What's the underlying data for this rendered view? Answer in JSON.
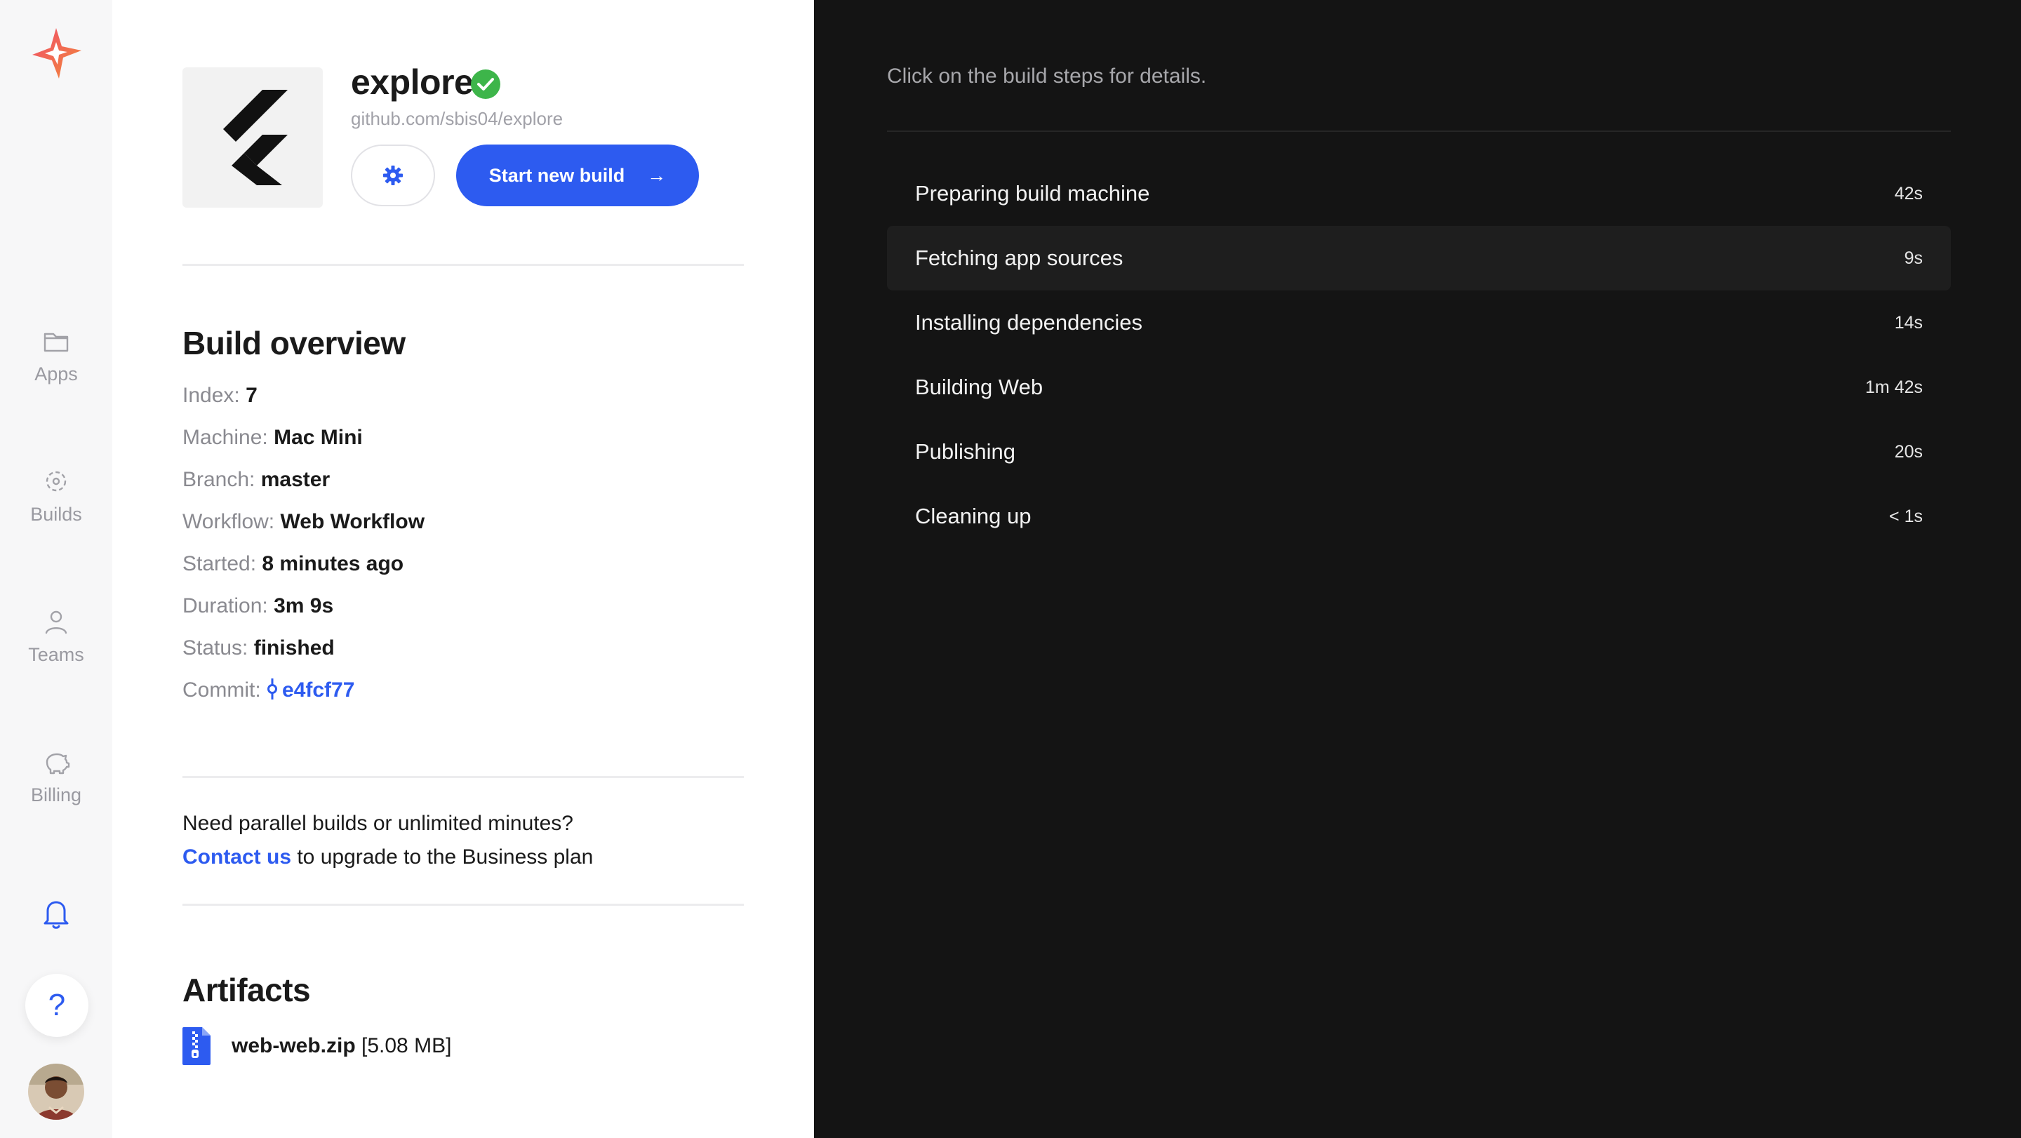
{
  "sidebar": {
    "items": [
      {
        "label": "Apps",
        "icon": "folder-icon"
      },
      {
        "label": "Builds",
        "icon": "builds-icon"
      },
      {
        "label": "Teams",
        "icon": "user-icon"
      },
      {
        "label": "Billing",
        "icon": "piggy-bank-icon"
      }
    ],
    "help_label": "?"
  },
  "app": {
    "name": "explore",
    "repo": "github.com/sbis04/explore",
    "start_build_label": "Start new build",
    "start_build_arrow": "→"
  },
  "overview": {
    "title": "Build overview",
    "rows": [
      {
        "key": "Index:",
        "value": "7"
      },
      {
        "key": "Machine:",
        "value": "Mac Mini"
      },
      {
        "key": "Branch:",
        "value": "master"
      },
      {
        "key": "Workflow:",
        "value": "Web Workflow"
      },
      {
        "key": "Started:",
        "value": "8 minutes ago"
      },
      {
        "key": "Duration:",
        "value": "3m 9s"
      },
      {
        "key": "Status:",
        "value": "finished"
      },
      {
        "key": "Commit:",
        "value": "e4fcf77"
      }
    ]
  },
  "upgrade": {
    "line1": "Need parallel builds or unlimited minutes?",
    "link": "Contact us",
    "line2": " to upgrade to the Business plan"
  },
  "artifacts": {
    "title": "Artifacts",
    "file_name": "web-web.zip",
    "file_size": " [5.08 MB]"
  },
  "steps": {
    "hint": "Click on the build steps for details.",
    "items": [
      {
        "name": "Preparing build machine",
        "time": "42s"
      },
      {
        "name": "Fetching app sources",
        "time": "9s"
      },
      {
        "name": "Installing dependencies",
        "time": "14s"
      },
      {
        "name": "Building Web",
        "time": "1m 42s"
      },
      {
        "name": "Publishing",
        "time": "20s"
      },
      {
        "name": "Cleaning up",
        "time": "< 1s"
      }
    ]
  },
  "colors": {
    "accent": "#2d5bf0",
    "success": "#3db54a",
    "dark_bg": "#141414"
  }
}
